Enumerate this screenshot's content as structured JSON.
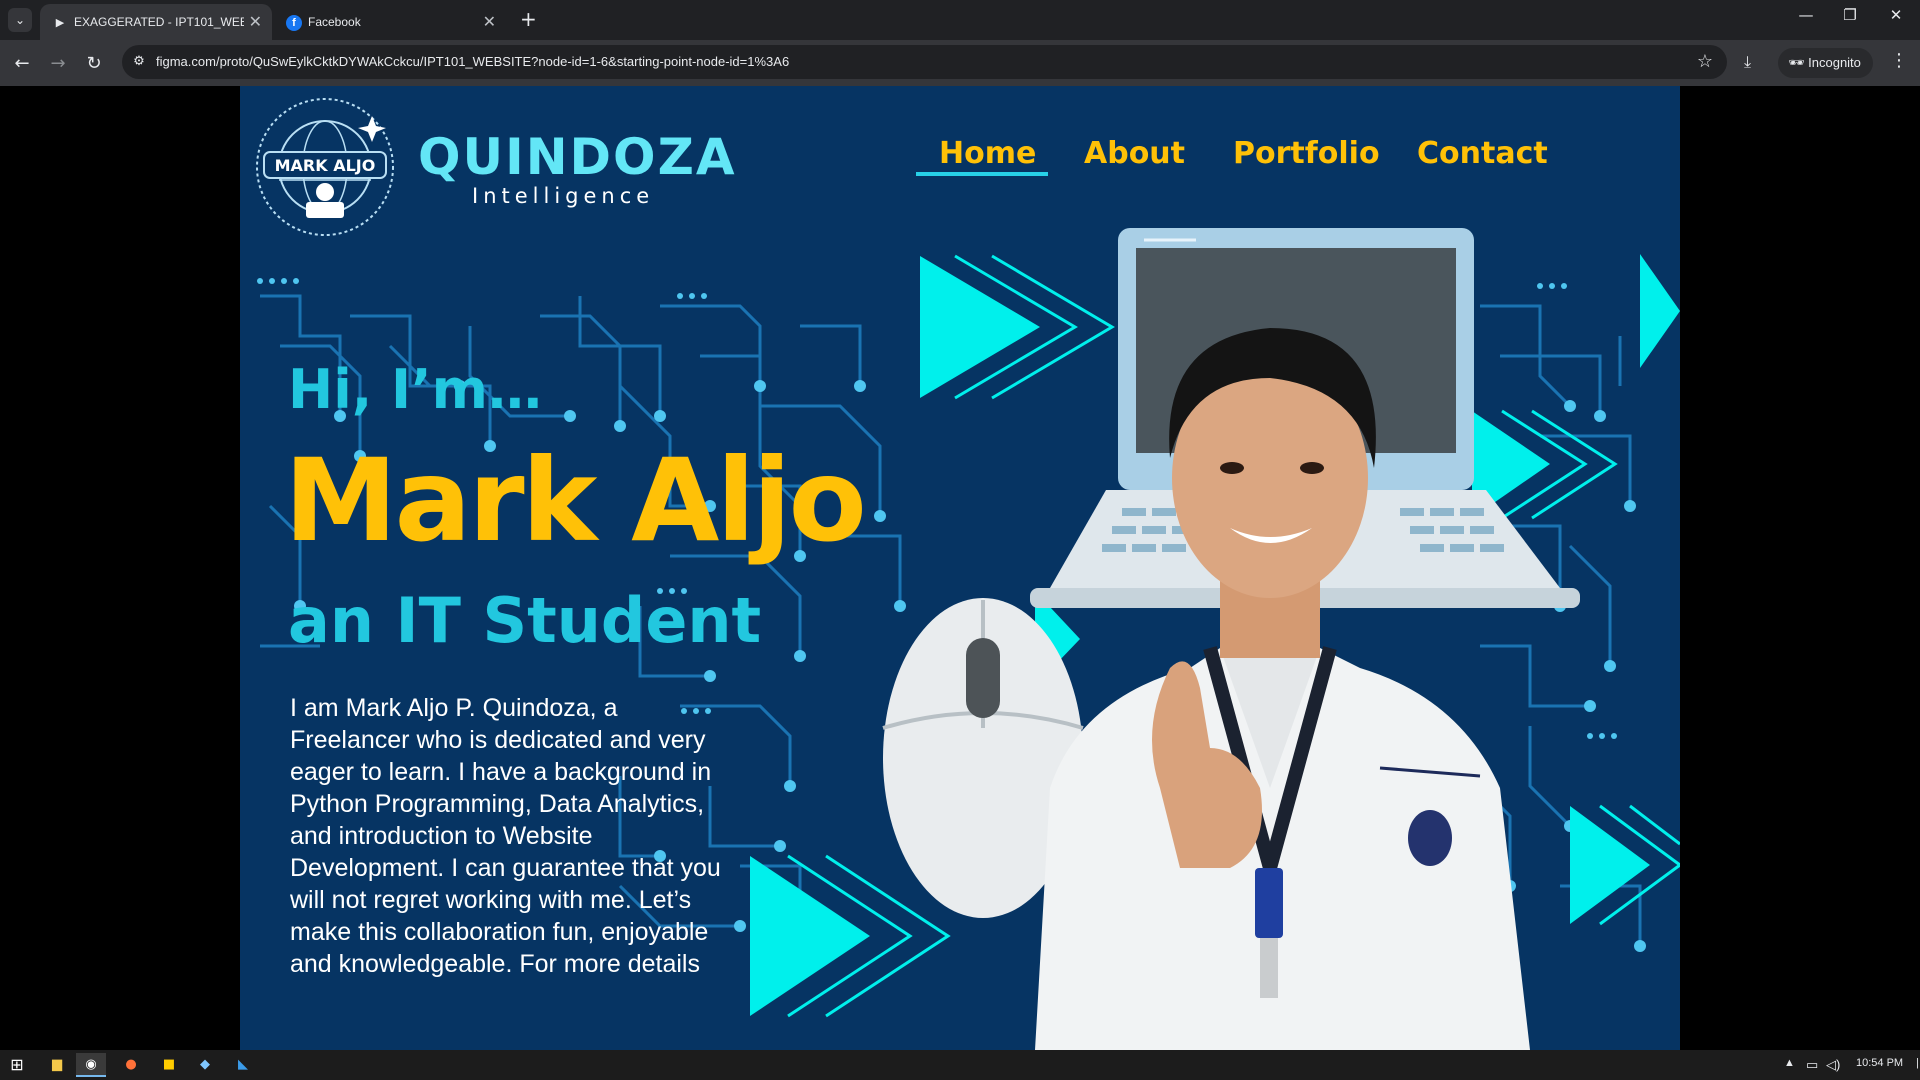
{
  "browser": {
    "tabs": [
      {
        "title": "EXAGGERATED - IPT101_WEBSI",
        "active": true,
        "favicon": "play-icon"
      },
      {
        "title": "Facebook",
        "active": false,
        "favicon": "facebook-icon"
      }
    ],
    "url": "figma.com/proto/QuSwEylkCktkDYWAkCckcu/IPT101_WEBSITE?node-id=1-6&starting-point-node-id=1%3A6",
    "profile_label": "Incognito"
  },
  "site": {
    "logo_text": "MARK ALJO",
    "brand": "QUINDOZA",
    "brand_sub": "Intelligence",
    "nav": {
      "home": "Home",
      "about": "About",
      "portfolio": "Portfolio",
      "contact": "Contact",
      "active": "Home"
    },
    "hero": {
      "greeting": "Hi, I’m…",
      "name": "Mark Aljo",
      "role": "an IT Student",
      "bio": "I am Mark Aljo P. Quindoza,  a Freelancer who is dedicated and very eager to learn.  I have a background in Python Programming, Data Analytics, and introduction to Website Development.  I can guarantee that you will not regret working with me. Let’s make this collaboration fun, enjoyable and knowledgeable. For more details"
    },
    "colors": {
      "background": "#063463",
      "accent_yellow": "#ffc107",
      "accent_cyan": "#22c7df",
      "triangle_cyan": "#00f0ec"
    }
  },
  "taskbar": {
    "time": "10:54 PM"
  }
}
